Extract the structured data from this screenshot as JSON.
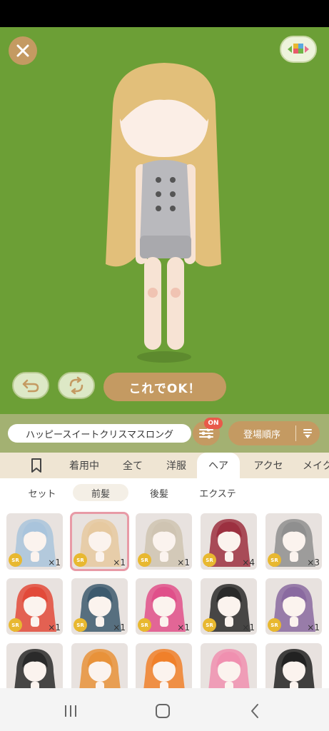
{
  "header": {
    "ok_label": "これでOK！"
  },
  "filterbar": {
    "name_value": "ハッピースイートクリスマスロング",
    "on_badge": "ON",
    "sort_label": "登場順序"
  },
  "tabs": [
    {
      "label": "着用中"
    },
    {
      "label": "全て"
    },
    {
      "label": "洋服"
    },
    {
      "label": "ヘア"
    },
    {
      "label": "アクセ"
    },
    {
      "label": "メイク"
    }
  ],
  "subtabs": [
    {
      "label": "セット"
    },
    {
      "label": "前髪"
    },
    {
      "label": "後髪"
    },
    {
      "label": "エクステ"
    }
  ],
  "items": [
    {
      "badge": "SR",
      "count": "×1",
      "hair": "#a9c4dc"
    },
    {
      "badge": "SR",
      "count": "×1",
      "hair": "#e6c9a0"
    },
    {
      "badge": "SR",
      "count": "×1",
      "hair": "#cfc4b2"
    },
    {
      "badge": "SR",
      "count": "×4",
      "hair": "#9c3040"
    },
    {
      "badge": "SR",
      "count": "×3",
      "hair": "#8f8f8f"
    },
    {
      "badge": "SR",
      "count": "×1",
      "hair": "#e24a3a"
    },
    {
      "badge": "SR",
      "count": "×1",
      "hair": "#3d5a6e"
    },
    {
      "badge": "SR",
      "count": "×1",
      "hair": "#e0508a"
    },
    {
      "badge": "SR",
      "count": "×1",
      "hair": "#2a2a2a"
    },
    {
      "badge": "SR",
      "count": "×1",
      "hair": "#8a6aa0"
    },
    {
      "badge": "",
      "count": "",
      "hair": "#2a2a2a"
    },
    {
      "badge": "",
      "count": "",
      "hair": "#e8923a"
    },
    {
      "badge": "",
      "count": "",
      "hair": "#f0802a"
    },
    {
      "badge": "",
      "count": "",
      "hair": "#f090b0"
    },
    {
      "badge": "",
      "count": "",
      "hair": "#222222"
    }
  ],
  "colors": {
    "stage_bg": "#6c9f36",
    "accent": "#c49a62",
    "selected_border": "#e89aa6"
  }
}
